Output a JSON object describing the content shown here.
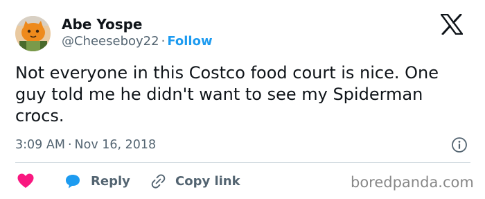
{
  "author": {
    "name": "Abe Yospe",
    "handle": "@Cheeseboy22",
    "separator": "·",
    "follow_label": "Follow"
  },
  "tweet": {
    "text": "Not everyone in this Costco food court is nice. One guy told me he didn't want to see my Spiderman crocs.",
    "time": "3:09 AM",
    "separator": "·",
    "date": "Nov 16, 2018"
  },
  "actions": {
    "reply_label": "Reply",
    "copy_label": "Copy link"
  },
  "icons": {
    "logo": "x-logo-icon",
    "info": "info-icon",
    "like": "heart-icon",
    "reply": "speech-bubble-icon",
    "copy": "link-icon"
  },
  "colors": {
    "accent": "#1d9bf0",
    "like": "#f91880",
    "secondary_text": "#536471",
    "primary_text": "#0f1419",
    "divider": "#cfd9de"
  },
  "watermark": "boredpanda.com"
}
